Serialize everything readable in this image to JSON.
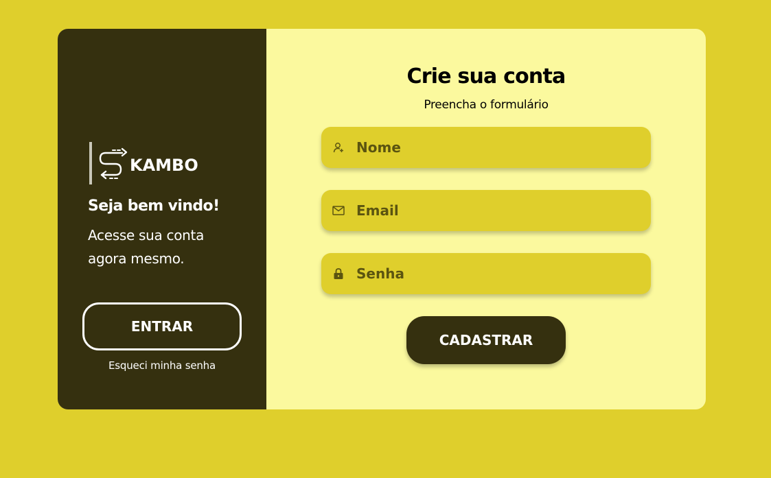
{
  "brand": {
    "name": "KAMBO",
    "logo_icon": "swap-arrows-s-icon"
  },
  "welcome": {
    "title": "Seja bem vindo!",
    "subtitle": "Acesse sua conta agora mesmo."
  },
  "login": {
    "enter_label": "ENTRAR",
    "forgot_label": "Esqueci minha senha"
  },
  "signup": {
    "title": "Crie sua conta",
    "subtitle": "Preencha o formulário",
    "fields": [
      {
        "icon": "user-add-icon",
        "placeholder": "Nome",
        "value": ""
      },
      {
        "icon": "envelope-icon",
        "placeholder": "Email",
        "value": ""
      },
      {
        "icon": "lock-icon",
        "placeholder": "Senha",
        "value": ""
      }
    ],
    "submit_label": "CADASTRAR"
  },
  "colors": {
    "background": "#dfcf2c",
    "dark_panel": "#35300f",
    "form_panel": "#fbf99e",
    "field_bg": "#dfcf2c",
    "field_text": "#5b5410"
  }
}
